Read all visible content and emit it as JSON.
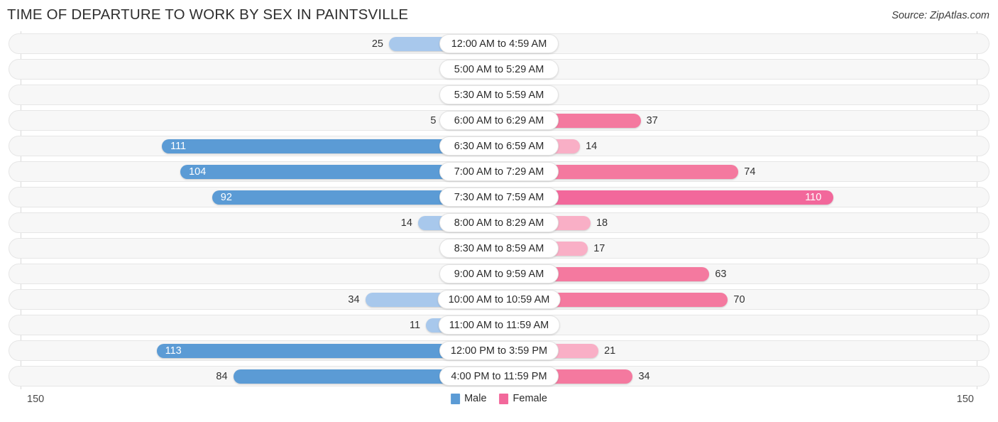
{
  "header": {
    "title": "TIME OF DEPARTURE TO WORK BY SEX IN PAINTSVILLE",
    "source": "Source: ZipAtlas.com"
  },
  "axis": {
    "left_max": "150",
    "right_max": "150"
  },
  "legend": {
    "items": [
      {
        "label": "Male",
        "color": "#5B9BD5"
      },
      {
        "label": "Female",
        "color": "#F2689B"
      }
    ]
  },
  "colors": {
    "male_strong": "#5B9BD5",
    "male_light": "#A8C8EC",
    "female_strong": "#F2689B",
    "female_light": "#F9AFC6",
    "track_bg": "#f7f7f7",
    "track_border": "#e6e6e6"
  },
  "chart_data": {
    "type": "bar",
    "orientation": "horizontal-diverging",
    "title": "TIME OF DEPARTURE TO WORK BY SEX IN PAINTSVILLE",
    "xlabel": "",
    "ylabel": "",
    "xlim": [
      -150,
      150
    ],
    "axis_max": 150,
    "grid": false,
    "legend_position": "bottom-center",
    "categories": [
      "12:00 AM to 4:59 AM",
      "5:00 AM to 5:29 AM",
      "5:30 AM to 5:59 AM",
      "6:00 AM to 6:29 AM",
      "6:30 AM to 6:59 AM",
      "7:00 AM to 7:29 AM",
      "7:30 AM to 7:59 AM",
      "8:00 AM to 8:29 AM",
      "8:30 AM to 8:59 AM",
      "9:00 AM to 9:59 AM",
      "10:00 AM to 10:59 AM",
      "11:00 AM to 11:59 AM",
      "12:00 PM to 3:59 PM",
      "4:00 PM to 11:59 PM"
    ],
    "series": [
      {
        "name": "Male",
        "color": "#5B9BD5",
        "side": "left",
        "values": [
          25,
          0,
          0,
          5,
          111,
          104,
          92,
          14,
          0,
          0,
          34,
          11,
          113,
          84
        ]
      },
      {
        "name": "Female",
        "color": "#F2689B",
        "side": "right",
        "values": [
          0,
          0,
          0,
          37,
          14,
          74,
          110,
          18,
          17,
          63,
          70,
          0,
          21,
          34
        ]
      }
    ]
  }
}
